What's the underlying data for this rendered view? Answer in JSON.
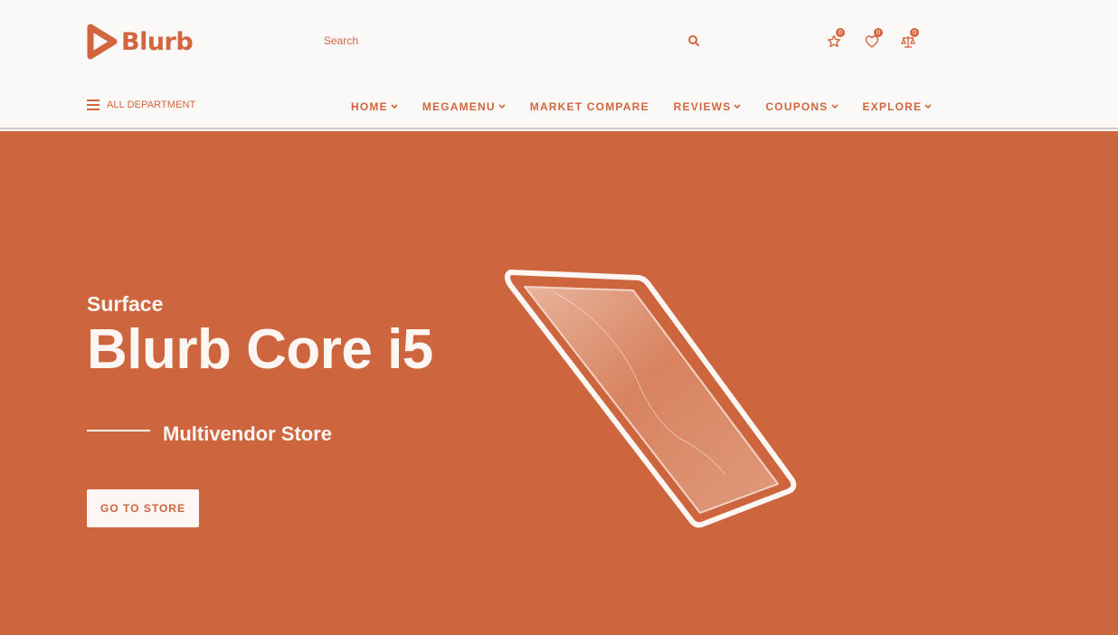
{
  "header": {
    "logo_text": "Blurb",
    "search": {
      "placeholder": "Search"
    },
    "icons": [
      {
        "name": "star-icon",
        "count": "0"
      },
      {
        "name": "heart-icon",
        "count": "0"
      },
      {
        "name": "compare-scale-icon",
        "count": "0"
      }
    ],
    "all_department": "ALL DEPARTMENT",
    "nav": [
      {
        "label": "HOME",
        "has_dropdown": true
      },
      {
        "label": "MEGAMENU",
        "has_dropdown": true
      },
      {
        "label": "MARKET COMPARE",
        "has_dropdown": false
      },
      {
        "label": "REVIEWS",
        "has_dropdown": true
      },
      {
        "label": "COUPONS",
        "has_dropdown": true
      },
      {
        "label": "EXPLORE",
        "has_dropdown": true
      }
    ]
  },
  "hero": {
    "subtitle": "Surface",
    "title": "Blurb Core i5",
    "tagline": "Multivendor Store",
    "button_label": "GO TO STORE"
  },
  "colors": {
    "accent": "#d2653e",
    "hero_background": "#cd663f",
    "header_background": "#faf9f8",
    "hero_text": "#fdf6f2"
  }
}
